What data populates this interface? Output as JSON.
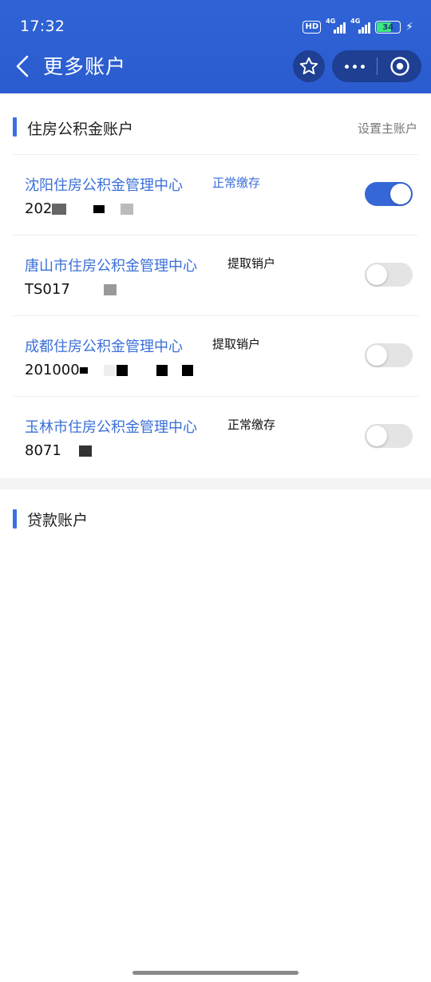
{
  "status_bar": {
    "time": "17:32",
    "hd_label": "HD",
    "net1": "4G",
    "net2": "4G",
    "battery": "34"
  },
  "nav": {
    "title": "更多账户",
    "back_icon": "chevron-left-icon",
    "favorite_icon": "star-icon",
    "more_icon": "more-dots-icon",
    "close_icon": "target-circle-icon"
  },
  "housing_fund": {
    "title": "住房公积金账户",
    "set_main_label": "设置主账户",
    "accounts": [
      {
        "center": "沈阳住房公积金管理中心",
        "status": "正常缴存",
        "number": "202",
        "enabled": true
      },
      {
        "center": "唐山市住房公积金管理中心",
        "status": "提取销户",
        "number": "TS017",
        "enabled": false
      },
      {
        "center": "成都住房公积金管理中心",
        "status": "提取销户",
        "number": "201000",
        "enabled": false
      },
      {
        "center": "玉林市住房公积金管理中心",
        "status": "正常缴存",
        "number": "8071",
        "enabled": false
      }
    ]
  },
  "loan": {
    "title": "贷款账户"
  },
  "colors": {
    "header": "#2f63d6",
    "accent": "#3a6fd8",
    "toggle_on": "#3567d6",
    "toggle_off": "#e4e4e4"
  }
}
